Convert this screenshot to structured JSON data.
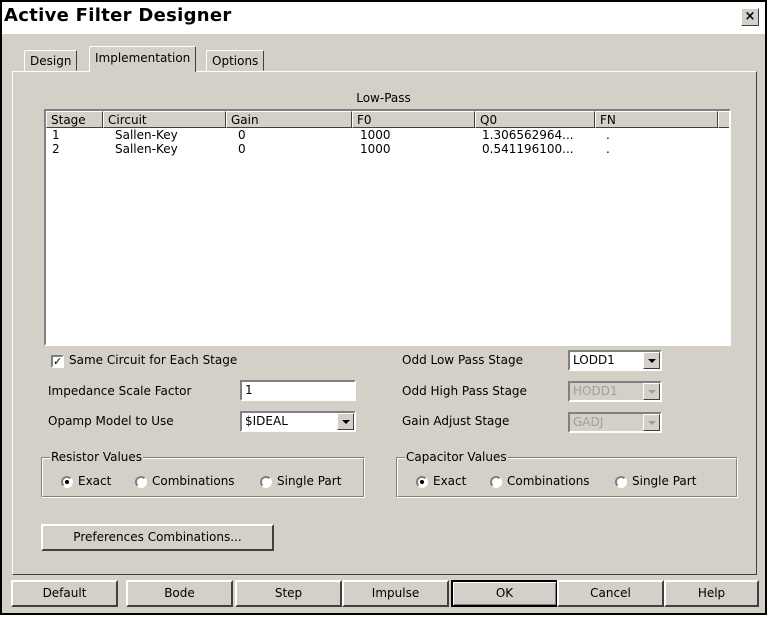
{
  "window": {
    "title": "Active Filter Designer",
    "close_symbol": "×"
  },
  "tabs": [
    {
      "label": "Design",
      "active": false
    },
    {
      "label": "Implementation",
      "active": true
    },
    {
      "label": "Options",
      "active": false
    }
  ],
  "stage_list": {
    "caption": "Low-Pass",
    "columns": [
      "Stage",
      "Circuit",
      "Gain",
      "F0",
      "Q0",
      "FN"
    ],
    "rows": [
      [
        "1",
        "Sallen-Key",
        "0",
        "1000",
        "1.306562964...",
        "."
      ],
      [
        "2",
        "Sallen-Key",
        "0",
        "1000",
        "0.541196100...",
        "."
      ]
    ]
  },
  "settings": {
    "same_circuit_label": "Same Circuit for Each Stage",
    "same_circuit_checked": true,
    "check_mark": "✓",
    "impedance_label": "Impedance Scale Factor",
    "impedance_value": "1",
    "opamp_label": "Opamp Model to Use",
    "opamp_value": "$IDEAL",
    "odd_low_label": "Odd Low Pass Stage",
    "odd_low_value": "LODD1",
    "odd_high_label": "Odd High Pass Stage",
    "odd_high_value": "HODD1",
    "gain_adjust_label": "Gain Adjust Stage",
    "gain_adjust_value": "GADJ"
  },
  "resistor_group": {
    "title": "Resistor Values",
    "options": [
      "Exact",
      "Combinations",
      "Single Part"
    ],
    "selected": "Exact"
  },
  "capacitor_group": {
    "title": "Capacitor Values",
    "options": [
      "Exact",
      "Combinations",
      "Single Part"
    ],
    "selected": "Exact"
  },
  "preferences_button": "Preferences Combinations...",
  "bottom_buttons": [
    "Default",
    "Bode",
    "Step",
    "Impulse",
    "OK",
    "Cancel",
    "Help"
  ],
  "default_button": "OK"
}
